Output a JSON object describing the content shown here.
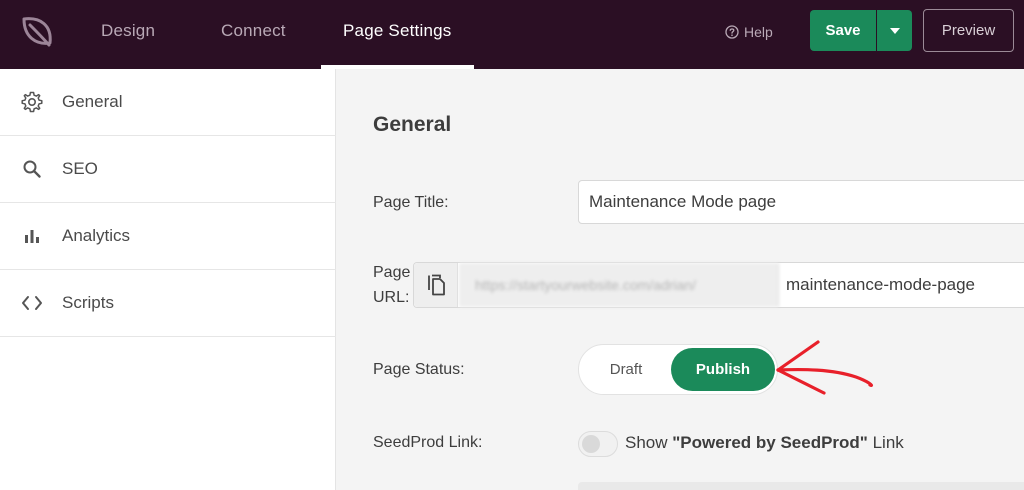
{
  "header": {
    "logo_icon": "seedprod-leaf-icon",
    "tabs": [
      {
        "label": "Design",
        "active": false
      },
      {
        "label": "Connect",
        "active": false
      },
      {
        "label": "Page Settings",
        "active": true
      }
    ],
    "help_label": "Help",
    "save_label": "Save",
    "preview_label": "Preview"
  },
  "sidebar": {
    "items": [
      {
        "label": "General",
        "icon": "gear-icon"
      },
      {
        "label": "SEO",
        "icon": "search-icon"
      },
      {
        "label": "Analytics",
        "icon": "bar-chart-icon"
      },
      {
        "label": "Scripts",
        "icon": "code-icon"
      }
    ]
  },
  "main": {
    "section_title": "General",
    "page_title": {
      "label": "Page Title:",
      "value": "Maintenance Mode page"
    },
    "page_url": {
      "label_line1": "Page",
      "label_line2": "URL:",
      "base": "https://startyourwebsite.com/adrian/",
      "slug": "maintenance-mode-page"
    },
    "page_status": {
      "label": "Page Status:",
      "options": [
        "Draft",
        "Publish"
      ],
      "selected": "Publish"
    },
    "seedprod_link": {
      "label": "SeedProd Link:",
      "enabled": false,
      "text_before": "Show ",
      "text_bold": "\"Powered by SeedProd\"",
      "text_after": " Link"
    }
  },
  "colors": {
    "header_bg": "#2b0f24",
    "accent_green": "#1b8a5a",
    "annotation_red": "#e8202a"
  }
}
